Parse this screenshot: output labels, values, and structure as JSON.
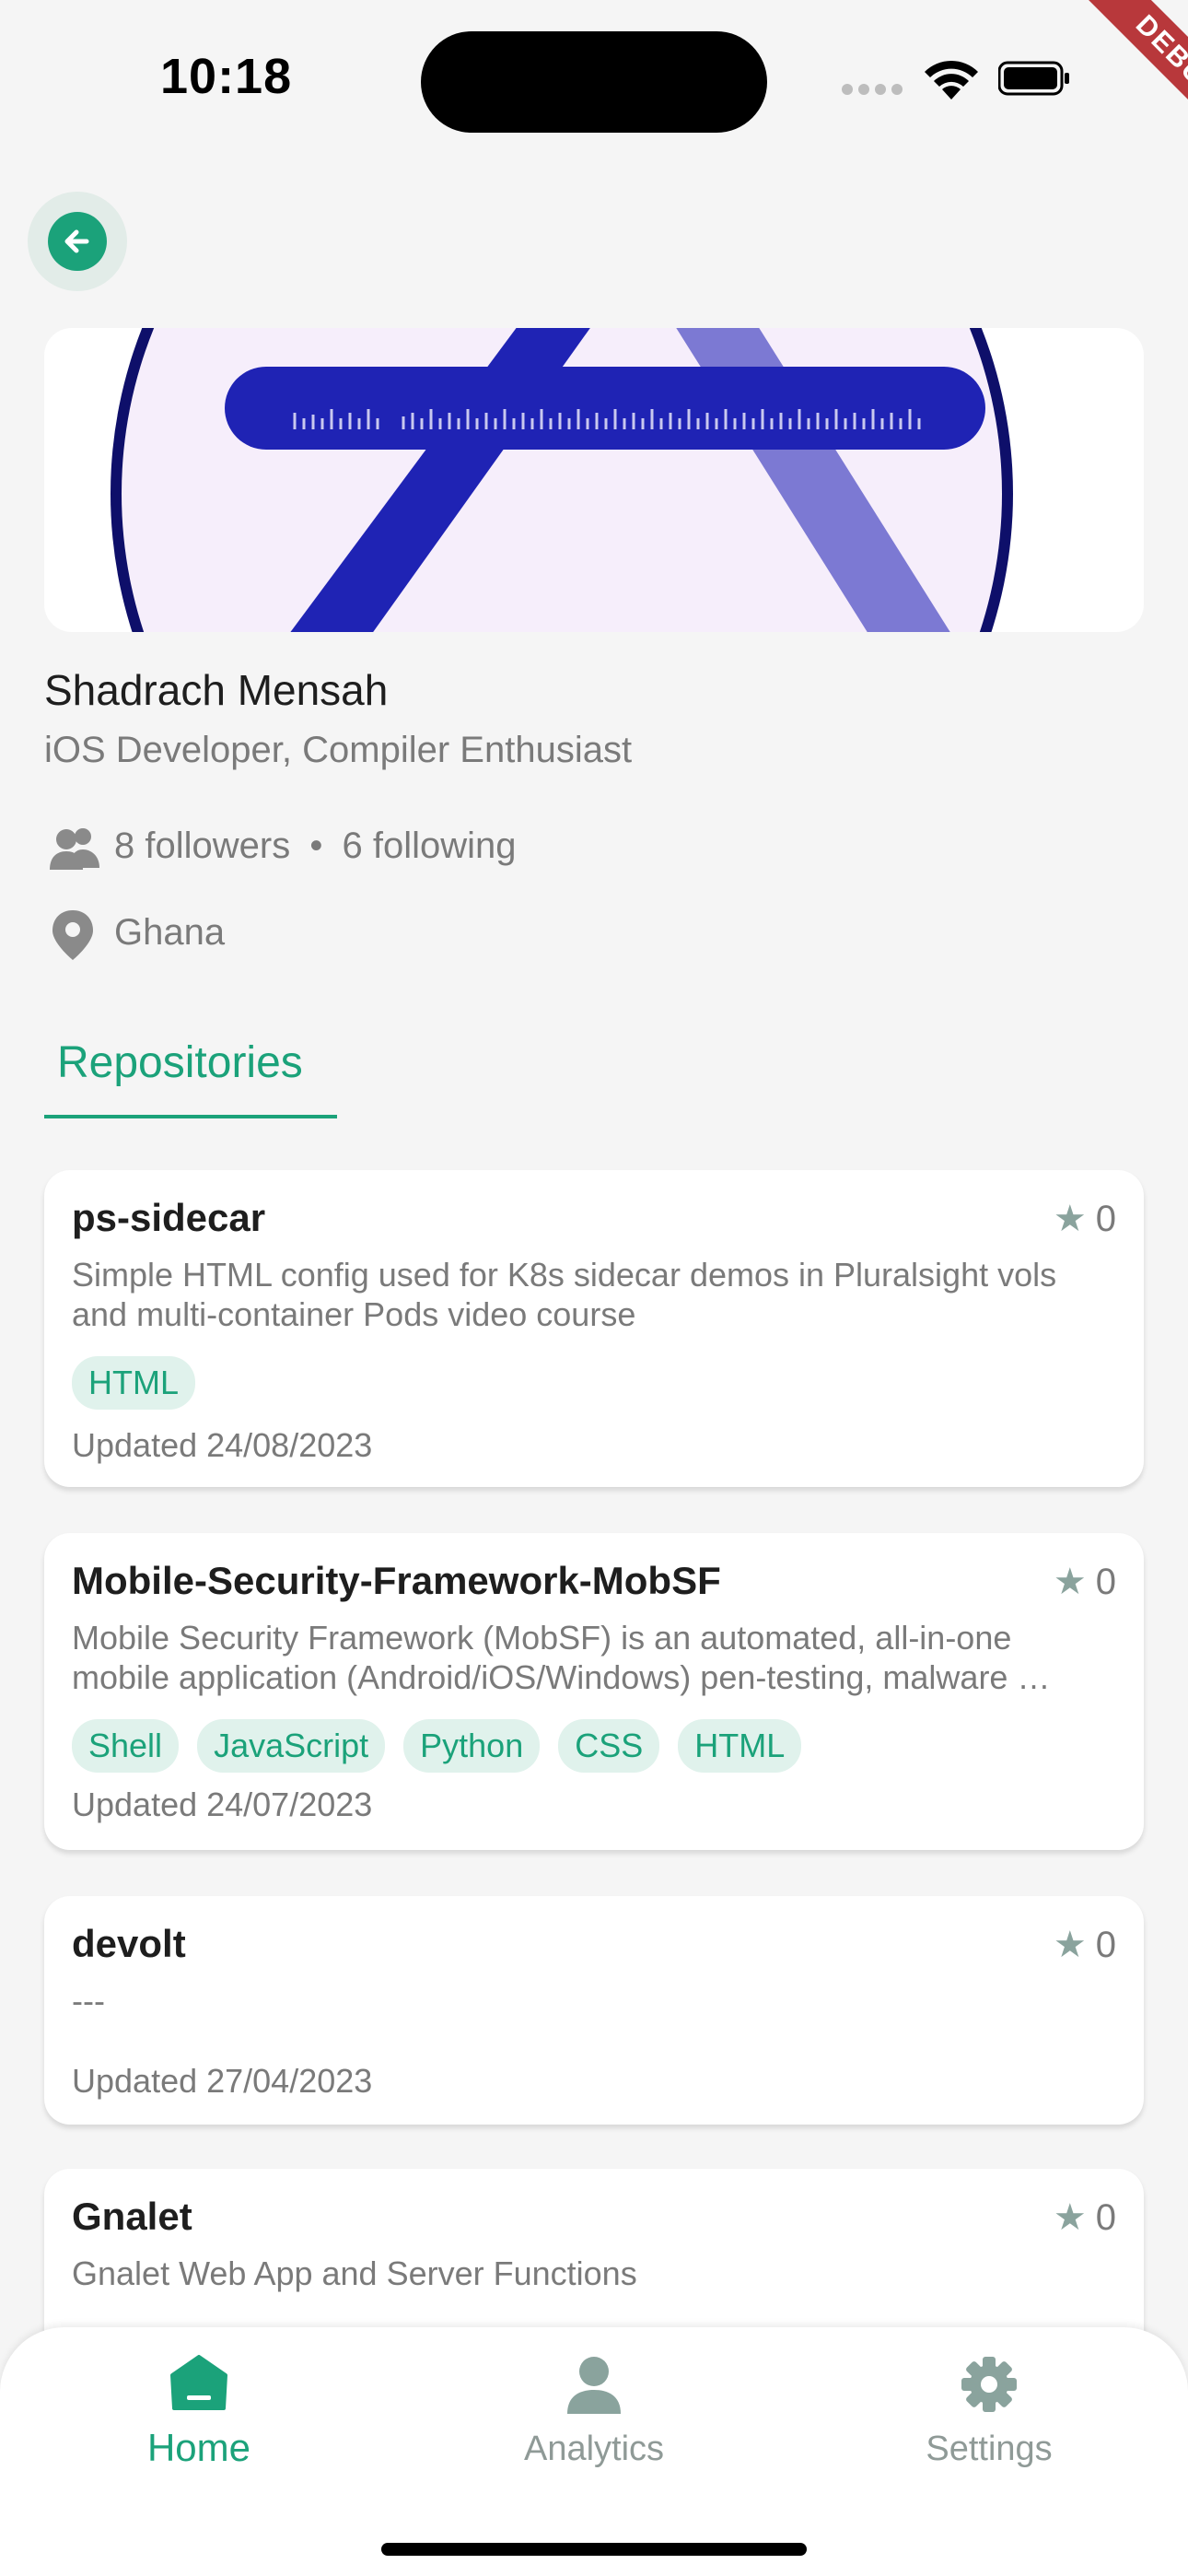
{
  "status_bar": {
    "time": "10:18"
  },
  "debug_label": "DEBUG",
  "profile": {
    "name": "Shadrach Mensah",
    "bio": "iOS Developer, Compiler Enthusiast",
    "followers": "8 followers",
    "separator": "•",
    "following": "6 following",
    "location": "Ghana"
  },
  "tabs": [
    {
      "label": "Repositories",
      "active": true
    }
  ],
  "repos": [
    {
      "name": "ps-sidecar",
      "stars": "0",
      "description": "Simple HTML config used for K8s sidecar demos in Pluralsight vols and multi-container Pods video course",
      "languages": [
        "HTML"
      ],
      "updated": "Updated 24/08/2023"
    },
    {
      "name": "Mobile-Security-Framework-MobSF",
      "stars": "0",
      "description": "Mobile Security Framework (MobSF) is an automated, all-in-one mobile application (Android/iOS/Windows) pen-testing, malware …",
      "languages": [
        "Shell",
        "JavaScript",
        "Python",
        "CSS",
        "HTML"
      ],
      "updated": "Updated 24/07/2023"
    },
    {
      "name": "devolt",
      "stars": "0",
      "description": "---",
      "languages": [],
      "updated": "Updated 27/04/2023"
    },
    {
      "name": "Gnalet",
      "stars": "0",
      "description": "Gnalet Web App and Server Functions",
      "languages": [],
      "updated": ""
    }
  ],
  "bottom_nav": [
    {
      "label": "Home",
      "icon": "home-icon",
      "active": true
    },
    {
      "label": "Analytics",
      "icon": "person-icon",
      "active": false
    },
    {
      "label": "Settings",
      "icon": "gear-icon",
      "active": false
    }
  ],
  "colors": {
    "accent": "#1ba27a",
    "banner_blue": "#1f23b4",
    "muted": "#7a7a7a"
  }
}
